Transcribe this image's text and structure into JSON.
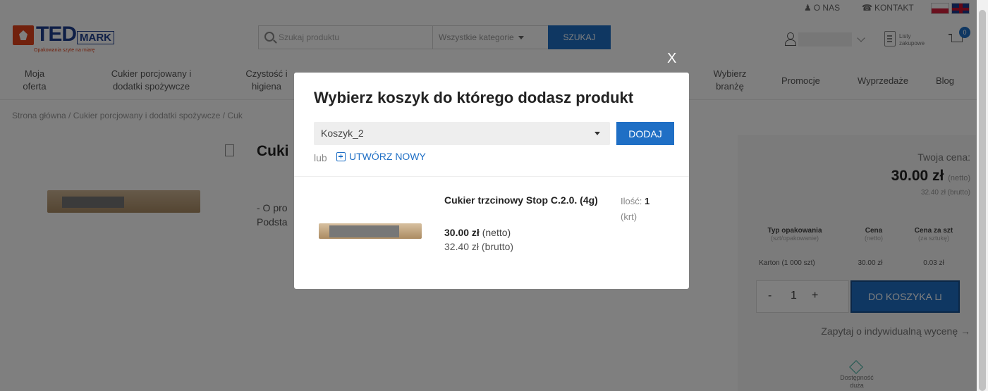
{
  "topbar": {
    "about": "O NAS",
    "contact": "KONTAKT"
  },
  "logo": {
    "ted": "TED",
    "mark": "MARK",
    "tagline": "Opakowania szyte na miarę"
  },
  "search": {
    "placeholder": "Szukaj produktu",
    "category": "Wszystkie kategorie",
    "button": "SZUKAJ"
  },
  "account": {
    "lists_label": "Listy zakupowe",
    "cart_count": "0"
  },
  "nav": {
    "items": [
      "Moja oferta",
      "Cukier porcjowany i dodatki spożywcze",
      "Czystość i higiena",
      "Wybierz branżę",
      "Promocje",
      "Wyprzedaże",
      "Blog"
    ]
  },
  "breadcrumb": "Strona główna / Cukier porcjowany i dodatki spożywcze / Cuk",
  "product": {
    "title_partial": "Cuki",
    "desc_line1": "- O pro",
    "desc_line2": "Podsta"
  },
  "panel": {
    "your_price": "Twoja cena:",
    "price": "30.00 zł",
    "price_net": "(netto)",
    "price_gross": "32.40 zł (brutto)",
    "table_headers": [
      {
        "title": "Typ opakowania",
        "sub": "(szt/opakowanie)"
      },
      {
        "title": "Cena",
        "sub": "(netto)"
      },
      {
        "title": "Cena za szt",
        "sub": "(za sztukę)"
      }
    ],
    "row": {
      "type": "Karton (1 000 szt)",
      "price": "30.00 zł",
      "unit": "0.03 zł"
    },
    "qty_minus": "-",
    "qty_value": "1",
    "qty_plus": "+",
    "to_cart": "DO KOSZYKA",
    "ask": "Zapytaj o indywidualną wycenę →",
    "availability": "Dostępność duża"
  },
  "modal": {
    "close": "X",
    "title": "Wybierz koszyk do którego dodasz produkt",
    "selected_basket": "Koszyk_2",
    "add_button": "DODAJ",
    "or": "lub",
    "create_new": "UTWÓRZ NOWY",
    "product_name": "Cukier trzcinowy Stop C.2.0. (4g)",
    "qty_label": "Ilość:",
    "qty_value": "1",
    "qty_unit": "(krt)",
    "price_net_value": "30.00 zł",
    "price_net_label": "(netto)",
    "price_gross": "32.40 zł (brutto)"
  },
  "colors": {
    "accent": "#1f6fc5",
    "brand_orange": "#e2421b",
    "brand_navy": "#1f3f8f"
  }
}
